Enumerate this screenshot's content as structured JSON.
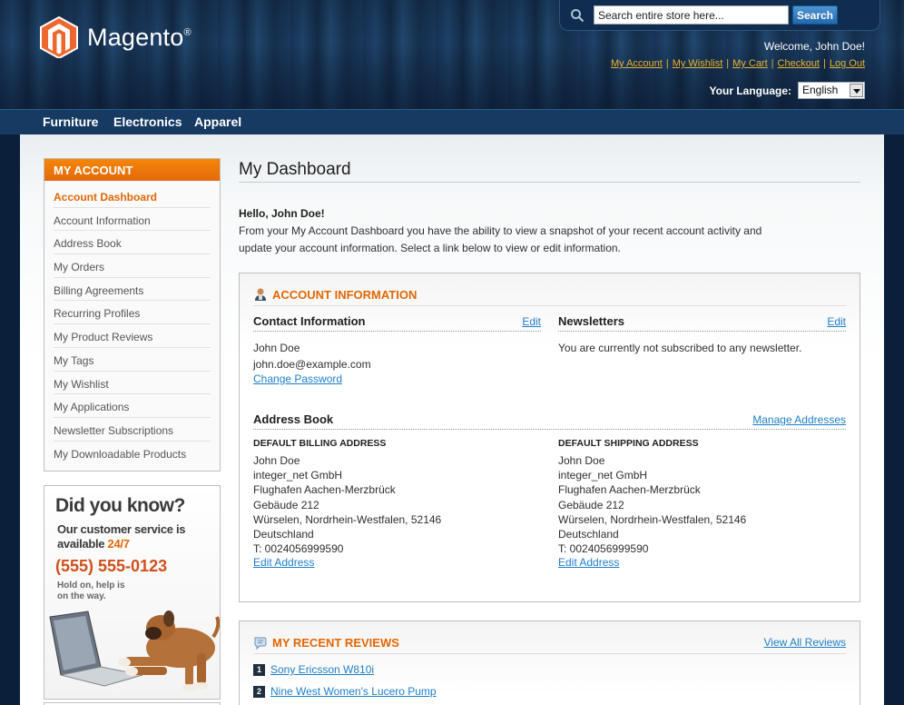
{
  "header": {
    "logo_text": "Magento",
    "logo_reg": "®",
    "search": {
      "placeholder": "Search entire store here...",
      "value": "Search entire store here...",
      "button_label": "Search"
    },
    "welcome": "Welcome, John Doe!",
    "quick_links": [
      "My Account",
      "My Wishlist",
      "My Cart",
      "Checkout",
      "Log Out"
    ],
    "language": {
      "label": "Your Language:",
      "selected": "English"
    }
  },
  "nav": {
    "items": [
      "Furniture",
      "Electronics",
      "Apparel"
    ]
  },
  "sidebar": {
    "title": "My Account",
    "items": [
      "Account Dashboard",
      "Account Information",
      "Address Book",
      "My Orders",
      "Billing Agreements",
      "Recurring Profiles",
      "My Product Reviews",
      "My Tags",
      "My Wishlist",
      "My Applications",
      "Newsletter Subscriptions",
      "My Downloadable Products"
    ],
    "active_index": 0
  },
  "promo": {
    "title": "Did you know?",
    "line1": "Our customer service is",
    "line2": "available",
    "line2_highlight": "24/7",
    "phone": "(555) 555-0123",
    "small1": "Hold on, help is",
    "small2": "on the way."
  },
  "main": {
    "title": "My Dashboard",
    "hello": "Hello, John Doe!",
    "intro": "From your My Account Dashboard you have the ability to view a snapshot of your recent account activity and update your account information. Select a link below to view or edit information."
  },
  "account_info": {
    "title": "Account Information",
    "contact": {
      "title": "Contact Information",
      "edit_label": "Edit",
      "name": "John Doe",
      "email": "john.doe@example.com",
      "change_password": "Change Password"
    },
    "newsletters": {
      "title": "Newsletters",
      "edit_label": "Edit",
      "text": "You are currently not subscribed to any newsletter."
    },
    "address_book": {
      "title": "Address Book",
      "manage_label": "Manage Addresses",
      "billing": {
        "heading": "Default Billing Address",
        "lines": [
          "John Doe",
          "integer_net GmbH",
          "Flughafen Aachen-Merzbrück",
          "Gebäude 212",
          "Würselen, Nordrhein-Westfalen, 52146",
          "Deutschland",
          "T: 0024056999590"
        ],
        "edit_label": "Edit Address"
      },
      "shipping": {
        "heading": "Default Shipping Address",
        "lines": [
          "John Doe",
          "integer_net GmbH",
          "Flughafen Aachen-Merzbrück",
          "Gebäude 212",
          "Würselen, Nordrhein-Westfalen, 52146",
          "Deutschland",
          "T: 0024056999590"
        ],
        "edit_label": "Edit Address"
      }
    }
  },
  "reviews": {
    "title": "My Recent Reviews",
    "view_all": "View All Reviews",
    "items": [
      {
        "num": "1",
        "name": "Sony Ericsson W810i"
      },
      {
        "num": "2",
        "name": "Nine West Women's Lucero Pump"
      }
    ]
  },
  "colors": {
    "accent": "#e26703",
    "link": "#1e7ec8",
    "header_link": "#e8b130",
    "nav_bg": "#163a62"
  }
}
